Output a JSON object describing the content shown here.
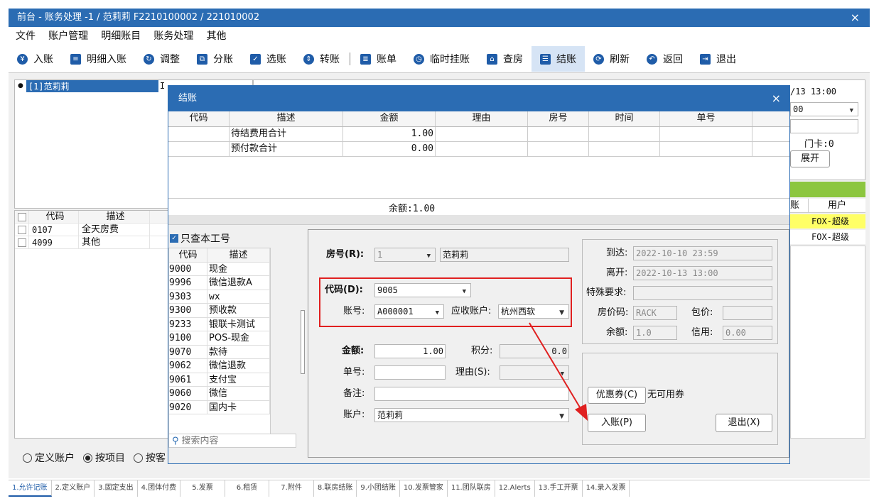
{
  "window": {
    "title": "前台 - 账务处理 -1 / 范莉莉 F2210100002 / 221010002",
    "close_glyph": "×"
  },
  "menu": [
    "文件",
    "账户管理",
    "明细账目",
    "账务处理",
    "其他"
  ],
  "toolbar": [
    {
      "icon": "yen-icon",
      "glyph": "¥",
      "label": "入账"
    },
    {
      "icon": "list-icon",
      "glyph": "≡",
      "label": "明细入账"
    },
    {
      "icon": "adjust-icon",
      "glyph": "↻",
      "label": "调整"
    },
    {
      "icon": "split-icon",
      "glyph": "⧉",
      "label": "分账"
    },
    {
      "icon": "select-icon",
      "glyph": "✓",
      "label": "选账"
    },
    {
      "icon": "transfer-icon",
      "glyph": "⇕",
      "label": "转账"
    },
    {
      "icon": "bill-icon",
      "glyph": "≣",
      "label": "账单"
    },
    {
      "icon": "clock-icon",
      "glyph": "◷",
      "label": "临时挂账"
    },
    {
      "icon": "house-icon",
      "glyph": "⌂",
      "label": "查房"
    },
    {
      "icon": "database-icon",
      "glyph": "☰",
      "label": "结账"
    },
    {
      "icon": "refresh-icon",
      "glyph": "⟳",
      "label": "刷新"
    },
    {
      "icon": "back-icon",
      "glyph": "↶",
      "label": "返回"
    },
    {
      "icon": "exit-icon",
      "glyph": "⇥",
      "label": "退出"
    }
  ],
  "left_account": {
    "item": "[1]范莉莉",
    "cursor": "I"
  },
  "left_items": {
    "headers": [
      "代码",
      "描述"
    ],
    "rows": [
      [
        "0107",
        "全天房费"
      ],
      [
        "4099",
        "其他"
      ]
    ]
  },
  "radios": [
    "定义账户",
    "按项目",
    "按客"
  ],
  "right_partial": {
    "datetime": "/13 13:00",
    "combo": "00",
    "card": "门卡:0",
    "expand": "展开",
    "col_zhang": "账",
    "col_user": "用户",
    "user1": "FOX-超级",
    "user2": "FOX-超级"
  },
  "bottom_tabs": [
    "1.允许记账",
    "2.定义账户",
    "3.固定支出",
    "4.团体付费",
    "5.发票",
    "6.租赁",
    "7.附件",
    "8.联房结账",
    "9.小团结账",
    "10.发票管家",
    "11.团队联房",
    "12.Alerts",
    "13.手工开票",
    "14.录入发票"
  ],
  "dialog": {
    "title": "结账",
    "close": "×",
    "grid_headers": [
      "代码",
      "描述",
      "金额",
      "理由",
      "房号",
      "时间",
      "单号"
    ],
    "grid_rows": [
      {
        "desc": "待结费用合计",
        "amount": "1.00"
      },
      {
        "desc": "预付款合计",
        "amount": "0.00"
      }
    ],
    "balance": "余额:1.00",
    "only_mine": "只查本工号",
    "code_headers": [
      "代码",
      "描述"
    ],
    "codes": [
      [
        "9000",
        "现金"
      ],
      [
        "9996",
        "微信退款A"
      ],
      [
        "9303",
        "wx"
      ],
      [
        "9300",
        "预收款"
      ],
      [
        "9233",
        "银联卡测试"
      ],
      [
        "9100",
        "POS-现金"
      ],
      [
        "9070",
        "款待"
      ],
      [
        "9062",
        "微信退款"
      ],
      [
        "9061",
        "支付宝"
      ],
      [
        "9060",
        "微信"
      ],
      [
        "9020",
        "国内卡"
      ]
    ],
    "search_placeholder": "搜索内容",
    "form": {
      "room_label": "房号(R):",
      "room_value": "1",
      "room_name": "范莉莉",
      "code_label": "代码(D):",
      "code_value": "9005",
      "account_label": "账号:",
      "account_value": "A000001",
      "ar_label": "应收账户:",
      "ar_value": "杭州西软",
      "amount_label": "金额:",
      "amount_value": "1.00",
      "points_label": "积分:",
      "points_value": "0.0",
      "bill_label": "单号:",
      "bill_value": "",
      "reason_label": "理由(S):",
      "reason_value": "",
      "note_label": "备注:",
      "note_value": "",
      "acct_label": "账户:",
      "acct_value": "范莉莉"
    },
    "info": {
      "arrive_label": "到达:",
      "arrive_value": "2022-10-10 23:59",
      "leave_label": "离开:",
      "leave_value": "2022-10-13 13:00",
      "special_label": "特殊要求:",
      "special_value": "",
      "rate_label": "房价码:",
      "rate_value": "RACK",
      "pkg_label": "包价:",
      "pkg_value": "",
      "bal_label": "余额:",
      "bal_value": "1.0",
      "credit_label": "信用:",
      "credit_value": "0.00"
    },
    "coupon_btn": "优惠券(C)",
    "coupon_text": "无可用券",
    "post_btn": "入账(P)",
    "exit_btn": "退出(X)"
  },
  "colors": {
    "accent": "#2b6cb3",
    "highlight": "#e02020",
    "green_bar": "#8cc63f",
    "yellow_row": "#ffff66"
  }
}
